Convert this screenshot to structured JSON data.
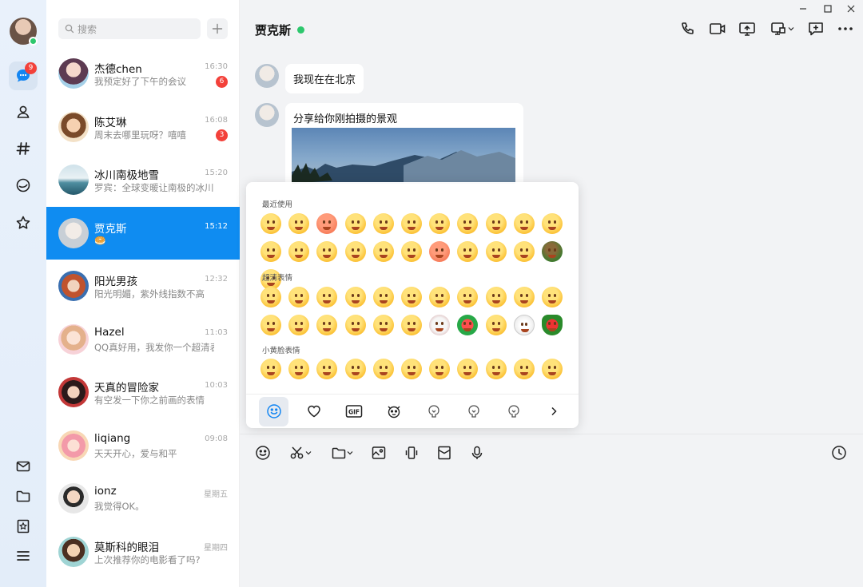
{
  "rail": {
    "badge": "9"
  },
  "list": {
    "search_placeholder": "搜索",
    "conversations": [
      {
        "name": "杰德chen",
        "preview": "我预定好了下午的会议",
        "time": "16:30",
        "unread": "6",
        "color": "#c9a0b6"
      },
      {
        "name": "陈艾琳",
        "preview": "周末去哪里玩呀？嘻嘻",
        "time": "16:08",
        "unread": "3",
        "color": "#e8b68f"
      },
      {
        "name": "冰川南极地雪",
        "preview": "罗宾：全球变暖让南极的冰川",
        "time": "15:20",
        "unread": "",
        "color": "#9cc0cc"
      },
      {
        "name": "贾克斯",
        "preview": "🥯",
        "time": "15:12",
        "unread": "",
        "color": "#dfe4e8"
      },
      {
        "name": "阳光男孩",
        "preview": "阳光明媚，紫外线指数不高",
        "time": "12:32",
        "unread": "",
        "color": "#c86b47"
      },
      {
        "name": "Hazel",
        "preview": "QQ真好用，我发你一个超清表情",
        "time": "11:03",
        "unread": "",
        "color": "#f0c6c6"
      },
      {
        "name": "天真的冒险家",
        "preview": "有空发一下你之前画的表情",
        "time": "10:03",
        "unread": "",
        "color": "#b33a3a"
      },
      {
        "name": "liqiang",
        "preview": "天天开心，爱与和平",
        "time": "09:08",
        "unread": "",
        "color": "#f3a7b0"
      },
      {
        "name": "ionz",
        "preview": "我觉得OK。",
        "time": "星期五",
        "unread": "",
        "color": "#d5d5d5"
      },
      {
        "name": "莫斯科的眼泪",
        "preview": "上次推荐你的电影看了吗?",
        "time": "星期四",
        "unread": "",
        "color": "#e9c08a"
      }
    ]
  },
  "chat": {
    "title": "贾克斯",
    "messages": [
      {
        "text": "我现在在北京"
      },
      {
        "text": "分享给你刚拍摄的景观"
      }
    ]
  },
  "emoji_panel": {
    "section_recent": "最近使用",
    "section_hd": "超清表情",
    "section_small": "小黄脸表情",
    "tab_gif": "GIF"
  }
}
